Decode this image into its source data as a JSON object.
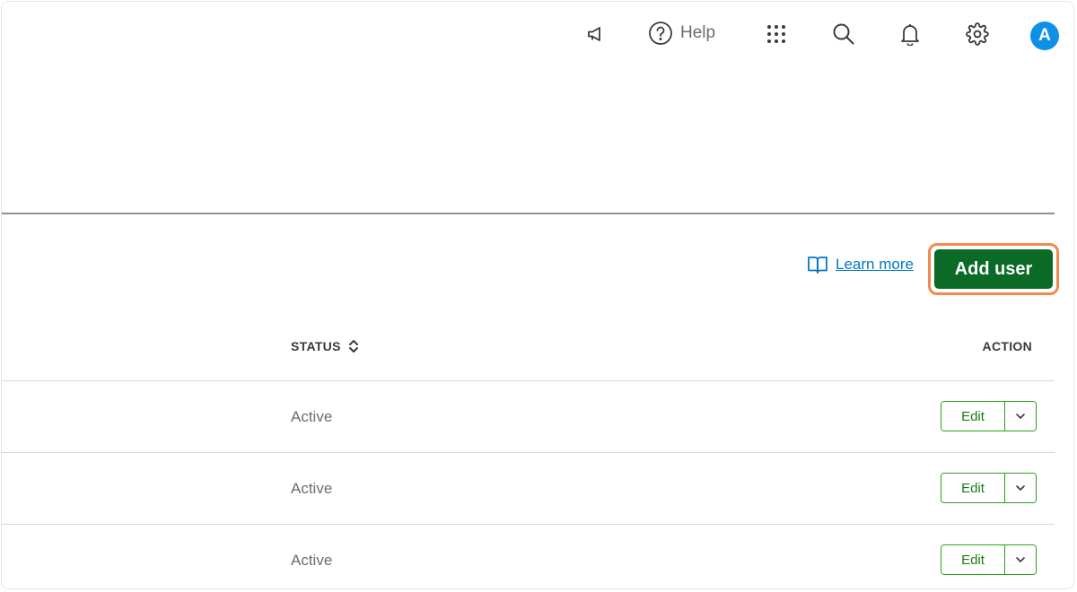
{
  "header": {
    "help_label": "Help",
    "avatar_initial": "A",
    "icons": [
      "megaphone-icon",
      "help-circle-icon",
      "app-grid-icon",
      "search-icon",
      "bell-icon",
      "gear-icon"
    ]
  },
  "toolbar": {
    "learn_more_label": "Learn more",
    "add_user_label": "Add user",
    "add_user_color": "#0b6b26",
    "highlight_color": "#f2894f"
  },
  "table": {
    "columns": {
      "status": "STATUS",
      "action": "ACTION"
    },
    "rows": [
      {
        "status": "Active",
        "edit_label": "Edit"
      },
      {
        "status": "Active",
        "edit_label": "Edit"
      },
      {
        "status": "Active",
        "edit_label": "Edit"
      }
    ]
  },
  "colors": {
    "link": "#0077c5",
    "button_outline": "#2ca01c",
    "avatar_bg": "#0d91e8"
  }
}
